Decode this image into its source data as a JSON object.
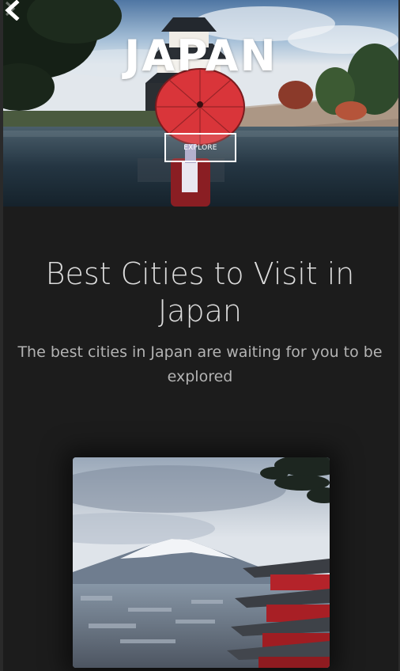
{
  "hero": {
    "title": "JAPAN",
    "explore_label": "EXPLORE",
    "prev_icon": "chevron-left-icon",
    "next_icon": "chevron-right-icon"
  },
  "section": {
    "headline": "Best Cities to Visit in Japan",
    "subheading": "The best cities in Japan are waiting for you to be explored"
  },
  "colors": {
    "background": "#1c1c1c",
    "headline": "#dcdcdc",
    "subheading": "#b3b3b3",
    "button_border": "#ffffff"
  }
}
